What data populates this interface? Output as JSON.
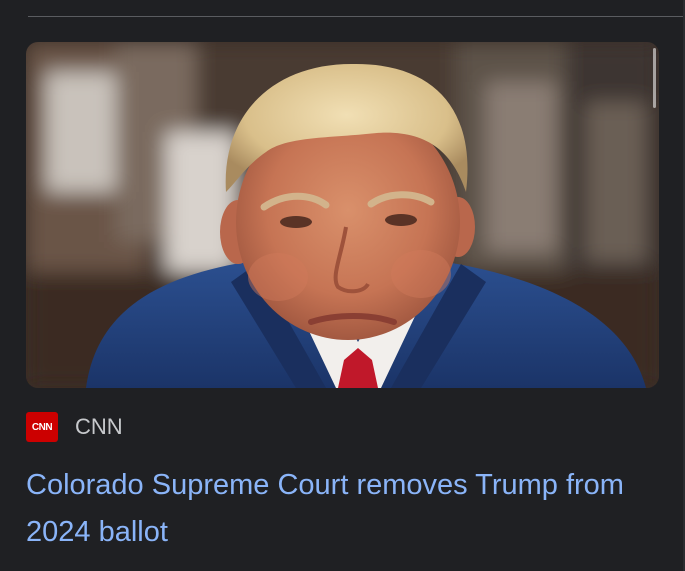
{
  "article": {
    "image_alt": "Donald Trump seated in a courtroom wearing a navy suit and red tie",
    "source": {
      "logo_text": "CNN",
      "name": "CNN",
      "logo_color": "#cc0000"
    },
    "headline": "Colorado Supreme Court removes Trump from 2024 ballot",
    "headline_color": "#8ab4f8"
  }
}
